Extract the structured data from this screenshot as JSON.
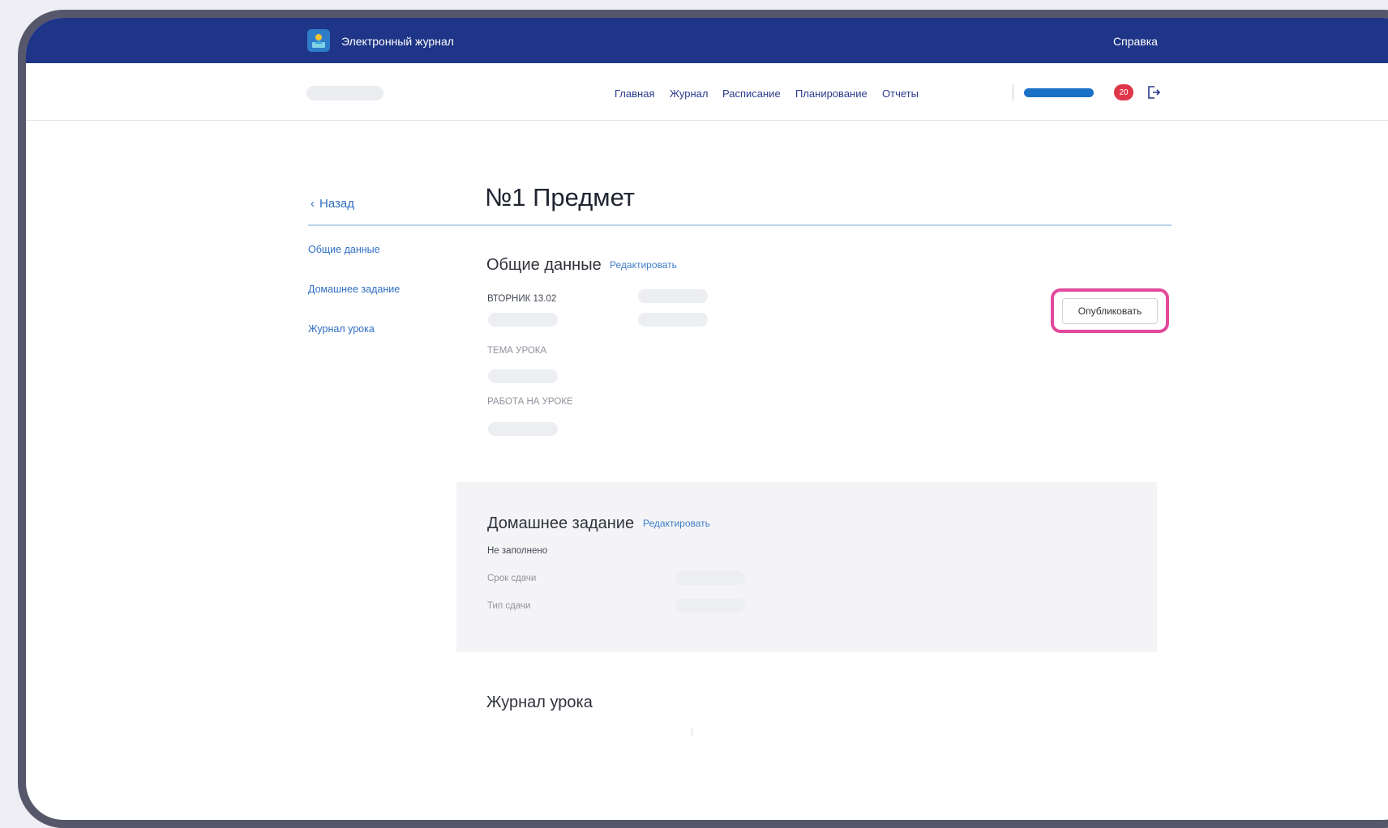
{
  "topbar": {
    "app_title": "Электронный журнал",
    "help_link": "Справка",
    "logo_icon": "school-logo-icon"
  },
  "nav": {
    "items": [
      "Главная",
      "Журнал",
      "Расписание",
      "Планирование",
      "Отчеты"
    ],
    "notification_count": "20",
    "logout_icon": "logout-icon"
  },
  "page": {
    "back_label": "Назад",
    "title": "№1 Предмет"
  },
  "sidebar": {
    "items": [
      "Общие данные",
      "Домашнее задание",
      "Журнал урока"
    ]
  },
  "general": {
    "title": "Общие данные",
    "edit_label": "Редактировать",
    "date_label": "ВТОРНИК 13.02",
    "topic_label": "ТЕМА УРОКА",
    "work_label": "РАБОТА НА УРОКЕ",
    "publish_label": "Опубликовать"
  },
  "homework": {
    "title": "Домашнее задание",
    "edit_label": "Редактировать",
    "status": "Не заполнено",
    "deadline_label": "Срок сдачи",
    "type_label": "Тип сдачи"
  },
  "lesson_log": {
    "title": "Журнал урока"
  },
  "colors": {
    "topbar": "#1f3587",
    "link": "#2f6fc2",
    "highlight": "#e2499b",
    "badge": "#e0364a"
  }
}
